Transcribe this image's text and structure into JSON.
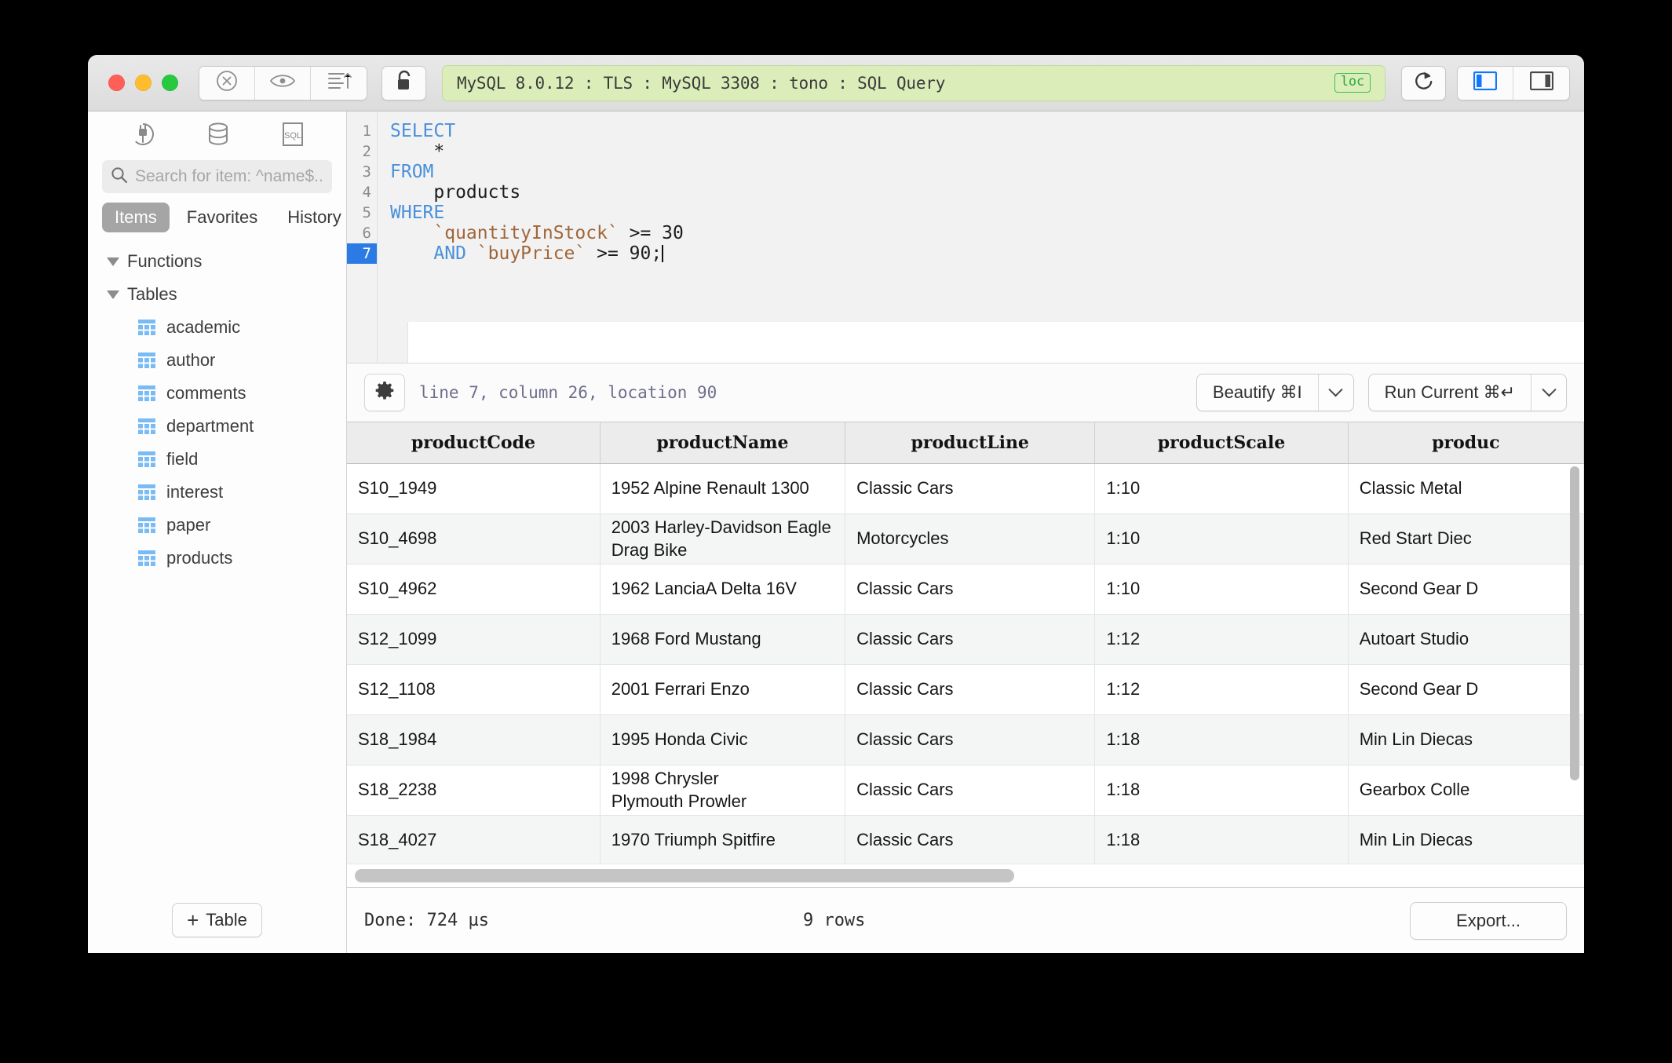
{
  "window": {
    "title": "MySQL 8.0.12 : TLS : MySQL 3308 : tono : SQL Query",
    "loc_badge": "loc",
    "title_bg": "#dbeeba",
    "accent": "#2c7be5"
  },
  "titlebar": {
    "buttons": [
      {
        "name": "cancel-icon",
        "label": ""
      },
      {
        "name": "eye-icon",
        "label": ""
      },
      {
        "name": "sort-ascending-icon",
        "label": ""
      }
    ],
    "lock_label": "",
    "refresh_label": "",
    "left_panel_toggle": "",
    "right_panel_toggle": ""
  },
  "sidebar": {
    "icons": [
      "plug-icon",
      "database-icon",
      "sql-file-icon"
    ],
    "search": {
      "placeholder": "Search for item: ^name$...",
      "value": ""
    },
    "tabs": [
      {
        "label": "Items",
        "active": true
      },
      {
        "label": "Favorites",
        "active": false
      },
      {
        "label": "History",
        "active": false
      }
    ],
    "groups": [
      {
        "label": "Functions",
        "expanded": true,
        "items": []
      },
      {
        "label": "Tables",
        "expanded": true,
        "items": [
          "academic",
          "author",
          "comments",
          "department",
          "field",
          "interest",
          "paper",
          "products"
        ]
      }
    ],
    "add_table_label": "Table",
    "add_table_plus": "+"
  },
  "editor": {
    "line_numbers": [
      "1",
      "2",
      "3",
      "4",
      "5",
      "6",
      "7"
    ],
    "current_line": 7,
    "lines": [
      {
        "n": 1,
        "text": "SELECT"
      },
      {
        "n": 2,
        "text": "    *"
      },
      {
        "n": 3,
        "text": "FROM"
      },
      {
        "n": 4,
        "text": "    products"
      },
      {
        "n": 5,
        "text": "WHERE"
      },
      {
        "n": 6,
        "text": "    `quantityInStock` >= 30"
      },
      {
        "n": 7,
        "text": "    AND `buyPrice` >= 90;"
      }
    ],
    "tokens": {
      "kw_select": "SELECT",
      "star": "    *",
      "kw_from": "FROM",
      "tbl_products": "    products",
      "kw_where": "WHERE",
      "l6_indent": "    ",
      "l6_ident": "`quantityInStock`",
      "l6_rest": " >= 30",
      "l7_indent": "    ",
      "l7_and": "AND",
      "l7_ident": " `buyPrice`",
      "l7_rest": " >= 90;"
    }
  },
  "editor_toolbar": {
    "gear": "gear-icon",
    "position": "line 7, column 26, location 90",
    "beautify_label": "Beautify ⌘I",
    "run_label": "Run Current ⌘↵"
  },
  "results": {
    "columns": [
      "productCode",
      "productName",
      "productLine",
      "productScale",
      "produc"
    ],
    "rows": [
      [
        "S10_1949",
        "1952 Alpine Renault 1300",
        "Classic Cars",
        "1:10",
        "Classic Metal"
      ],
      [
        "S10_4698",
        "2003 Harley-Davidson Eagle\nDrag Bike",
        "Motorcycles",
        "1:10",
        "Red Start Diec"
      ],
      [
        "S10_4962",
        "1962 LanciaA Delta 16V",
        "Classic Cars",
        "1:10",
        "Second Gear D"
      ],
      [
        "S12_1099",
        "1968 Ford Mustang",
        "Classic Cars",
        "1:12",
        "Autoart Studio"
      ],
      [
        "S12_1108",
        "2001 Ferrari Enzo",
        "Classic Cars",
        "1:12",
        "Second Gear D"
      ],
      [
        "S18_1984",
        "1995 Honda Civic",
        "Classic Cars",
        "1:18",
        "Min Lin Diecas"
      ],
      [
        "S18_2238",
        "1998 Chrysler\nPlymouth Prowler",
        "Classic Cars",
        "1:18",
        "Gearbox Colle"
      ],
      [
        "S18_4027",
        "1970 Triumph Spitfire",
        "Classic Cars",
        "1:18",
        "Min Lin Diecas"
      ]
    ]
  },
  "status": {
    "done": "Done: 724 µs",
    "rows": "9 rows",
    "export_label": "Export..."
  }
}
